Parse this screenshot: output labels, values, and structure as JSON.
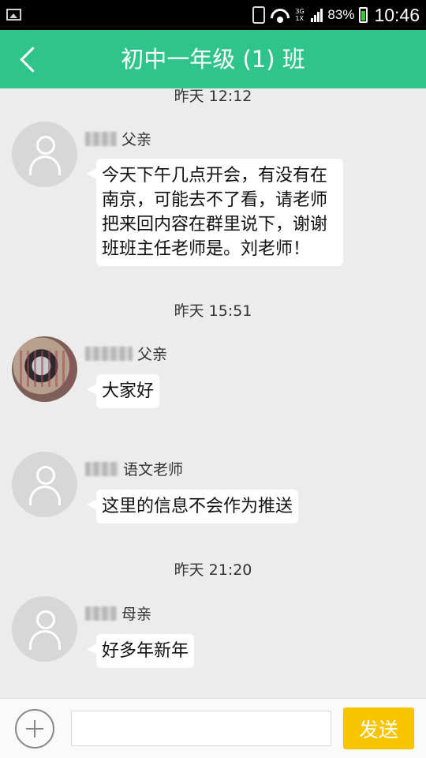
{
  "status_bar": {
    "network": "3G\n1X",
    "battery_percent": "83%",
    "time": "10:46",
    "icons": [
      "image-icon",
      "vibrate-icon",
      "wifi-icon",
      "signal-icon",
      "battery-icon"
    ]
  },
  "header": {
    "title": "初中一年级 (1) 班",
    "back_icon": "chevron-left-icon",
    "background": "#2fc48b"
  },
  "chat": {
    "messages": [
      {
        "time": "昨天 12:12"
      },
      {
        "sender_role": "父亲",
        "avatar": "default-user-avatar",
        "text": "今天下午几点开会，有没有在南京，可能去不了看，请老师把来回内容在群里说下，谢谢班班主任老师是。刘老师！"
      },
      {
        "time": "昨天 15:51"
      },
      {
        "sender_role": "父亲",
        "avatar": "photo-avatar",
        "text": "大家好"
      },
      {
        "sender_role": "语文老师",
        "avatar": "default-user-avatar",
        "text": "这里的信息不会作为推送"
      },
      {
        "time": "昨天 21:20"
      },
      {
        "sender_role": "母亲",
        "avatar": "default-user-avatar",
        "text": "好多年新年"
      }
    ]
  },
  "input_bar": {
    "add_icon": "plus-circle-icon",
    "input_value": "",
    "send_label": "发送",
    "send_color": "#f9c400"
  }
}
